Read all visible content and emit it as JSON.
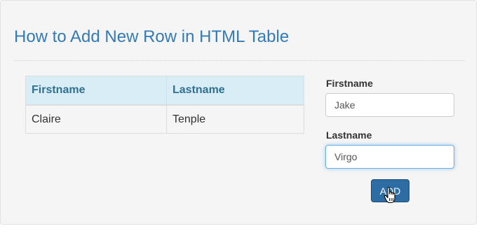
{
  "page": {
    "title": "How to Add New Row in HTML Table"
  },
  "table": {
    "headers": [
      "Firstname",
      "Lastname"
    ],
    "rows": [
      [
        "Claire",
        "Tenple"
      ]
    ]
  },
  "form": {
    "firstname_label": "Firstname",
    "firstname_value": "Jake",
    "lastname_label": "Lastname",
    "lastname_value": "Virgo",
    "add_label": "ADD",
    "focused_field": "lastname"
  },
  "icons": {
    "cursor": "hand-pointer-cursor-icon"
  },
  "colors": {
    "title": "#337ab7",
    "header_bg": "#d9edf7",
    "header_text": "#31708f",
    "button_bg": "#2e6da4",
    "panel_bg": "#f5f5f5",
    "focus_border": "#66afe9"
  }
}
